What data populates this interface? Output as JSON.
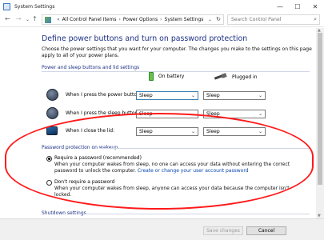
{
  "window": {
    "title": "System Settings",
    "min": "—",
    "max": "☐",
    "close": "✕"
  },
  "address": {
    "crumbs": [
      "All Control Panel Items",
      "Power Options",
      "System Settings"
    ],
    "search_placeholder": "Search Control Panel"
  },
  "page": {
    "title": "Define power buttons and turn on password protection",
    "description": "Choose the power settings that you want for your computer. The changes you make to the settings on this page apply to all of your power plans."
  },
  "power_section": {
    "heading": "Power and sleep buttons and lid settings",
    "col_battery": "On battery",
    "col_plugged": "Plugged in",
    "rows": [
      {
        "label": "When I press the power button:",
        "battery": "Sleep",
        "plugged": "Sleep"
      },
      {
        "label": "When I press the sleep button:",
        "battery": "Sleep",
        "plugged": "Sleep"
      },
      {
        "label": "When I close the lid:",
        "battery": "Sleep",
        "plugged": "Sleep"
      }
    ]
  },
  "password_section": {
    "heading": "Password protection on wakeup",
    "require_title": "Require a password (recommended)",
    "require_desc": "When your computer wakes from sleep, no one can access your data without entering the correct password to unlock the computer.",
    "require_link": "Create or change your user account password",
    "norequire_title": "Don't require a password",
    "norequire_desc": "When your computer wakes from sleep, anyone can access your data because the computer isn't locked.",
    "selected": "require"
  },
  "shutdown_section": {
    "heading": "Shutdown settings"
  },
  "footer": {
    "save_label": "Save changes",
    "cancel_label": "Cancel"
  },
  "colors": {
    "heading": "#1e3287",
    "annotation": "#ff1a1a",
    "link": "#0645ad"
  }
}
